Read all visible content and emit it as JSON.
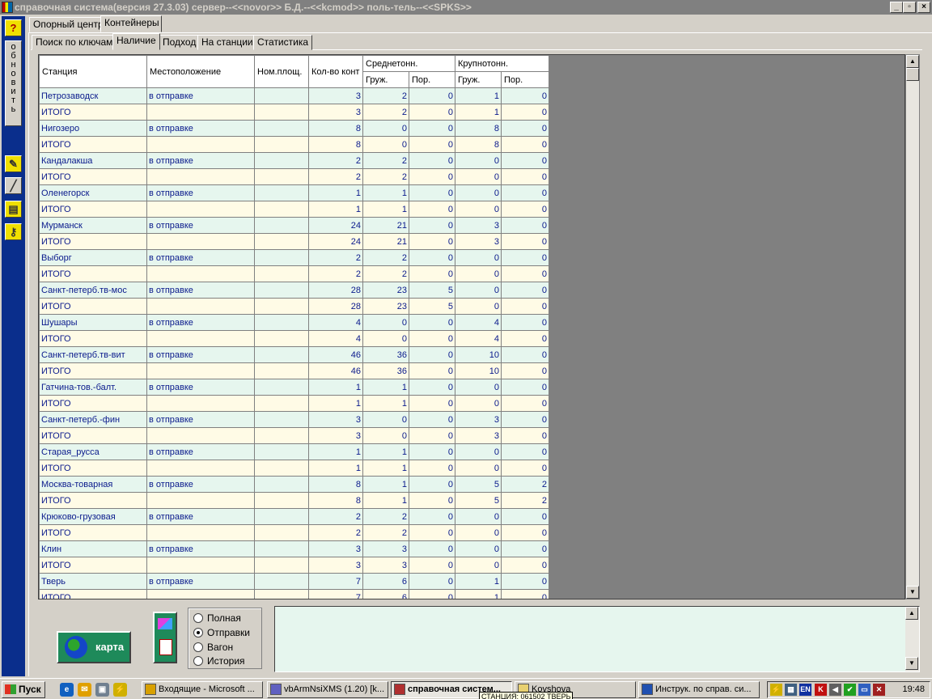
{
  "window": {
    "title": "справочная система(версия 27.3.03) сервер--<<novor>> Б.Д.--<<kcmod>> поль-тель--<<SPKS>>",
    "min": "_",
    "max": "▫",
    "close": "×"
  },
  "left_toolbar": {
    "help": "?",
    "refresh_letters": [
      "о",
      "б",
      "н",
      "о",
      "в",
      "и",
      "т",
      "ь"
    ]
  },
  "tabs_top": [
    "Опорный центр",
    "Контейнеры"
  ],
  "tabs_sub": [
    "Поиск по ключам",
    "Наличие",
    "Подход",
    "На станции",
    "Статистика"
  ],
  "grid": {
    "headers": {
      "station": "Станция",
      "location": "Местоположение",
      "platform": "Ном.площ.",
      "count": "Кол-во конт",
      "medium": "Среднетонн.",
      "large": "Крупнотонн.",
      "loaded": "Груж.",
      "empty": "Пор."
    },
    "rows": [
      [
        "Петрозаводск",
        "в отправке",
        "",
        "3",
        "2",
        "0",
        "1",
        "0"
      ],
      [
        "ИТОГО",
        "",
        "",
        "3",
        "2",
        "0",
        "1",
        "0"
      ],
      [
        "Нигозеро",
        "в отправке",
        "",
        "8",
        "0",
        "0",
        "8",
        "0"
      ],
      [
        "ИТОГО",
        "",
        "",
        "8",
        "0",
        "0",
        "8",
        "0"
      ],
      [
        "Кандалакша",
        "в отправке",
        "",
        "2",
        "2",
        "0",
        "0",
        "0"
      ],
      [
        "ИТОГО",
        "",
        "",
        "2",
        "2",
        "0",
        "0",
        "0"
      ],
      [
        "Оленегорск",
        "в отправке",
        "",
        "1",
        "1",
        "0",
        "0",
        "0"
      ],
      [
        "ИТОГО",
        "",
        "",
        "1",
        "1",
        "0",
        "0",
        "0"
      ],
      [
        "Мурманск",
        "в отправке",
        "",
        "24",
        "21",
        "0",
        "3",
        "0"
      ],
      [
        "ИТОГО",
        "",
        "",
        "24",
        "21",
        "0",
        "3",
        "0"
      ],
      [
        "Выборг",
        "в отправке",
        "",
        "2",
        "2",
        "0",
        "0",
        "0"
      ],
      [
        "ИТОГО",
        "",
        "",
        "2",
        "2",
        "0",
        "0",
        "0"
      ],
      [
        "Санкт-петерб.тв-мос",
        "в отправке",
        "",
        "28",
        "23",
        "5",
        "0",
        "0"
      ],
      [
        "ИТОГО",
        "",
        "",
        "28",
        "23",
        "5",
        "0",
        "0"
      ],
      [
        "Шушары",
        "в отправке",
        "",
        "4",
        "0",
        "0",
        "4",
        "0"
      ],
      [
        "ИТОГО",
        "",
        "",
        "4",
        "0",
        "0",
        "4",
        "0"
      ],
      [
        "Санкт-петерб.тв-вит",
        "в отправке",
        "",
        "46",
        "36",
        "0",
        "10",
        "0"
      ],
      [
        "ИТОГО",
        "",
        "",
        "46",
        "36",
        "0",
        "10",
        "0"
      ],
      [
        "Гатчина-тов.-балт.",
        "в отправке",
        "",
        "1",
        "1",
        "0",
        "0",
        "0"
      ],
      [
        "ИТОГО",
        "",
        "",
        "1",
        "1",
        "0",
        "0",
        "0"
      ],
      [
        "Санкт-петерб.-фин",
        "в отправке",
        "",
        "3",
        "0",
        "0",
        "3",
        "0"
      ],
      [
        "ИТОГО",
        "",
        "",
        "3",
        "0",
        "0",
        "3",
        "0"
      ],
      [
        "Старая_русса",
        "в отправке",
        "",
        "1",
        "1",
        "0",
        "0",
        "0"
      ],
      [
        "ИТОГО",
        "",
        "",
        "1",
        "1",
        "0",
        "0",
        "0"
      ],
      [
        "Москва-товарная",
        "в отправке",
        "",
        "8",
        "1",
        "0",
        "5",
        "2"
      ],
      [
        "ИТОГО",
        "",
        "",
        "8",
        "1",
        "0",
        "5",
        "2"
      ],
      [
        "Крюково-грузовая",
        "в отправке",
        "",
        "2",
        "2",
        "0",
        "0",
        "0"
      ],
      [
        "ИТОГО",
        "",
        "",
        "2",
        "2",
        "0",
        "0",
        "0"
      ],
      [
        "Клин",
        "в отправке",
        "",
        "3",
        "3",
        "0",
        "0",
        "0"
      ],
      [
        "ИТОГО",
        "",
        "",
        "3",
        "3",
        "0",
        "0",
        "0"
      ],
      [
        "Тверь",
        "в отправке",
        "",
        "7",
        "6",
        "0",
        "1",
        "0"
      ],
      [
        "ИТОГО",
        "",
        "",
        "7",
        "6",
        "0",
        "1",
        "0"
      ]
    ]
  },
  "bottom": {
    "map_button": "карта",
    "radio_options": [
      "Полная",
      "Отправки",
      "Вагон",
      "История"
    ],
    "radio_selected": 1
  },
  "taskbar": {
    "start": "Пуск",
    "buttons": [
      "Входящие - Microsoft ...",
      "vbArmNsiXMS (1.20)  [k...",
      "справочная систем...",
      "Kovshova",
      "Инструк. по справ. си..."
    ],
    "active_button": 2,
    "tray_lang": "EN",
    "clock": "19:48",
    "tooltip": "СТАНЦИЯ:   061502  ТВЕРЬ"
  }
}
